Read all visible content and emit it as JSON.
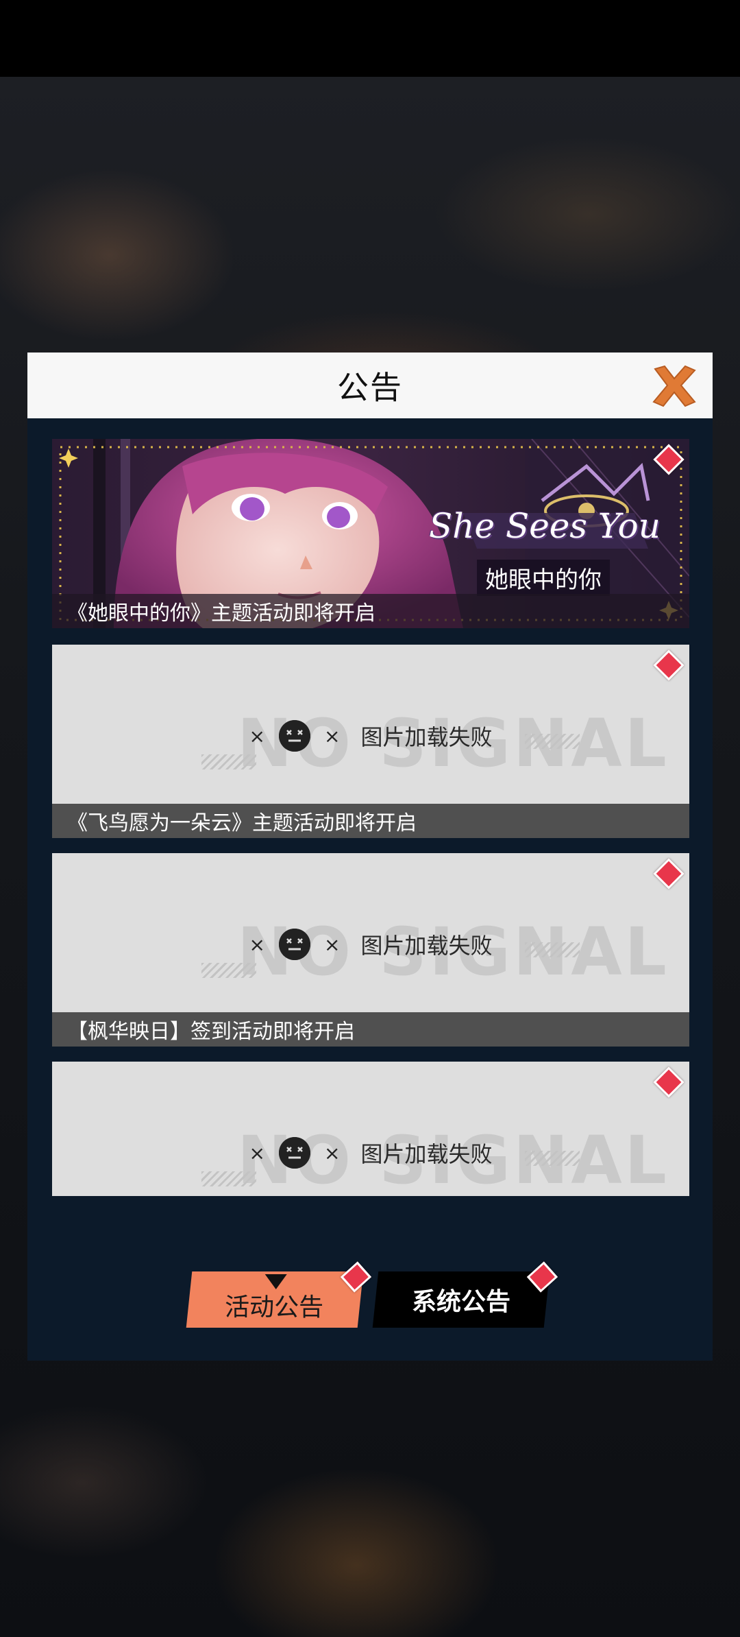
{
  "dialog": {
    "title": "公告",
    "close_icon": "close-x-icon"
  },
  "banners": [
    {
      "caption": "《她眼中的你》主题活动即将开启",
      "logo_en": "She Sees You",
      "logo_cn": "她眼中的你",
      "has_new_badge": true
    },
    {
      "caption": "《飞鸟愿为一朵云》主题活动即将开启",
      "placeholder_bg": "NO SIGNAL",
      "fail_text": "图片加载失败",
      "has_new_badge": true
    },
    {
      "caption": "【枫华映日】签到活动即将开启",
      "placeholder_bg": "NO SIGNAL",
      "fail_text": "图片加载失败",
      "has_new_badge": true
    },
    {
      "caption": "",
      "placeholder_bg": "NO SIGNAL",
      "fail_text": "图片加载失败",
      "has_new_badge": true
    }
  ],
  "tabs": {
    "activity": "活动公告",
    "system": "系统公告",
    "selected": "activity"
  },
  "colors": {
    "dialog_bg": "#0c1a2a",
    "header_bg": "#f7f7f7",
    "close_orange": "#e07a35",
    "tab_active": "#f2835d",
    "badge_red": "#e8364b"
  },
  "fail_marks": {
    "x": "×"
  }
}
